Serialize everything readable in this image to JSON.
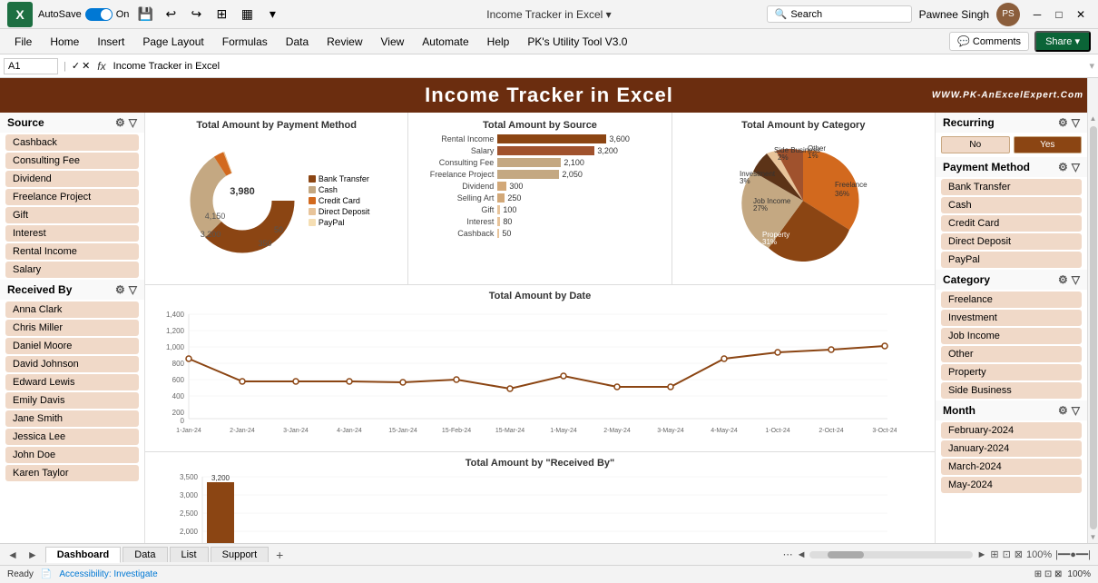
{
  "titlebar": {
    "app": "Excel",
    "autosave": "AutoSave",
    "autosave_state": "On",
    "title": "Income Tracker in Excel",
    "search_placeholder": "Search",
    "user": "Pawnee Singh",
    "user_initials": "PS"
  },
  "menu": {
    "items": [
      "File",
      "Home",
      "Insert",
      "Page Layout",
      "Formulas",
      "Data",
      "Review",
      "View",
      "Automate",
      "Help",
      "PK's Utility Tool V3.0"
    ],
    "comments": "Comments",
    "share": "Share"
  },
  "formula_bar": {
    "cell_ref": "A1",
    "formula": "Income Tracker in Excel"
  },
  "header": {
    "title": "Income Tracker in Excel",
    "website": "WWW.PK-AnExcelExpert.Com"
  },
  "left_sidebar": {
    "source_label": "Source",
    "source_items": [
      "Cashback",
      "Consulting Fee",
      "Dividend",
      "Freelance Project",
      "Gift",
      "Interest",
      "Rental Income",
      "Salary"
    ],
    "received_label": "Received By",
    "received_items": [
      "Anna Clark",
      "Chris Miller",
      "Daniel Moore",
      "David Johnson",
      "Edward Lewis",
      "Emily Davis",
      "Jane Smith",
      "Jessica Lee",
      "John Doe",
      "Karen Taylor"
    ]
  },
  "right_sidebar": {
    "recurring_label": "Recurring",
    "recurring_no": "No",
    "recurring_yes": "Yes",
    "payment_label": "Payment Method",
    "payment_items": [
      "Bank Transfer",
      "Cash",
      "Credit Card",
      "Direct Deposit",
      "PayPal"
    ],
    "category_label": "Category",
    "category_items": [
      "Freelance",
      "Investment",
      "Job Income",
      "Other",
      "Property",
      "Side Business"
    ],
    "month_label": "Month",
    "month_items": [
      "February-2024",
      "January-2024",
      "March-2024",
      "May-2024"
    ]
  },
  "chart1": {
    "title": "Total Amount  by Payment Method",
    "values": [
      4150,
      3200,
      3980,
      350,
      50
    ],
    "labels": [
      "Bank Transfer",
      "Cash",
      "Credit Card",
      "Direct Deposit",
      "PayPal"
    ],
    "colors": [
      "#8B4513",
      "#C4A882",
      "#D2691E",
      "#E8C49A",
      "#F5DEB3"
    ]
  },
  "chart2": {
    "title": "Total Amount by Source",
    "bars": [
      {
        "label": "Rental Income",
        "value": 3600,
        "max": 3600
      },
      {
        "label": "Salary",
        "value": 3200,
        "max": 3600
      },
      {
        "label": "Consulting Fee",
        "value": 2100,
        "max": 3600
      },
      {
        "label": "Freelance Project",
        "value": 2050,
        "max": 3600
      },
      {
        "label": "Dividend",
        "value": 300,
        "max": 3600
      },
      {
        "label": "Selling Art",
        "value": 250,
        "max": 3600
      },
      {
        "label": "Gift",
        "value": 100,
        "max": 3600
      },
      {
        "label": "Interest",
        "value": 80,
        "max": 3600
      },
      {
        "label": "Cashback",
        "value": 50,
        "max": 3600
      }
    ]
  },
  "chart3": {
    "title": "Total Amount by Category",
    "slices": [
      {
        "label": "Freelance",
        "value": 36,
        "color": "#D2691E"
      },
      {
        "label": "Property",
        "value": 31,
        "color": "#8B4513"
      },
      {
        "label": "Job Income",
        "value": 27,
        "color": "#C4A882"
      },
      {
        "label": "Investment",
        "value": 3,
        "color": "#5C3317"
      },
      {
        "label": "Other",
        "value": 1,
        "color": "#E8C49A"
      },
      {
        "label": "Side Business",
        "value": 2,
        "color": "#A0522D"
      }
    ]
  },
  "chart4": {
    "title": "Total Amount by Date",
    "y_labels": [
      "0",
      "200",
      "400",
      "600",
      "800",
      "1,000",
      "1,200",
      "1,400"
    ],
    "x_labels": [
      "1-Jan-24",
      "2-Jan-24",
      "3-Jan-24",
      "4-Jan-24",
      "15-Jan-24",
      "15-Feb-24",
      "15-Mar-24",
      "1-May-24",
      "2-May-24",
      "3-May-24",
      "4-May-24",
      "1-Oct-24",
      "2-Oct-24",
      "3-Oct-24"
    ],
    "points": [
      800,
      500,
      500,
      500,
      490,
      520,
      390,
      650,
      440,
      430,
      800,
      880,
      920,
      980
    ]
  },
  "chart5": {
    "title": "Total  Amount by \"Received By\"",
    "bars": [
      {
        "label": "",
        "value": 3200,
        "display": "3,200"
      }
    ],
    "y_labels": [
      "2,000",
      "2,500",
      "3,000",
      "3,500"
    ]
  },
  "tabs": {
    "items": [
      "Dashboard",
      "Data",
      "List",
      "Support"
    ],
    "active": "Dashboard",
    "add_label": "+"
  },
  "status": {
    "left": "Ready",
    "accessibility": "Accessibility: Investigate",
    "zoom": "100%"
  }
}
